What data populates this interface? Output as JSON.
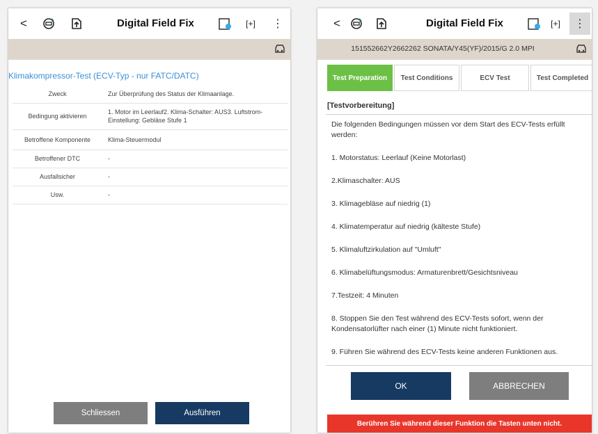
{
  "app": {
    "title": "Digital Field Fix"
  },
  "colors": {
    "accent_blue": "#3a8fd6",
    "primary_button": "#163a62",
    "secondary_button": "#7e7e7e",
    "active_tab": "#6cc045",
    "warning": "#e8362b",
    "info_bar": "#ded6cc"
  },
  "toolbar": {
    "icons": [
      "back-icon",
      "diagnostic-car-icon",
      "file-upload-icon",
      "battery-coin-icon",
      "fullscreen-icon",
      "more-vert-icon"
    ],
    "back_glyph": "<",
    "fullscreen_glyph": "[+]",
    "more_glyph": "⋮"
  },
  "left": {
    "heading": "Klimakompressor-Test (ECV-Typ - nur FATC/DATC)",
    "rows": [
      {
        "label": "Zweck",
        "value": "Zur Überprüfung des Status der Klimaanlage."
      },
      {
        "label": "Bedingung aktivieren",
        "value": "1. Motor im Leerlauf2. Klima-Schalter: AUS3. Luftstrom-Einstellung: Gebläse Stufe 1"
      },
      {
        "label": "Betroffene Komponente",
        "value": "Klima-Steuermodul"
      },
      {
        "label": "Betroffener DTC",
        "value": "-"
      },
      {
        "label": "Ausfallsicher",
        "value": "-"
      },
      {
        "label": "Usw.",
        "value": "-"
      }
    ],
    "close_label": "Schliessen",
    "run_label": "Ausführen"
  },
  "right": {
    "vehicle_info": "151552662Y2662262  SONATA/Y45(YF)/2015/G 2.0 MPI",
    "tabs": [
      {
        "label": "Test Preparation",
        "active": true
      },
      {
        "label": "Test Conditions",
        "active": false
      },
      {
        "label": "ECV Test",
        "active": false
      },
      {
        "label": "Test Completed",
        "active": false
      }
    ],
    "section_title": "[Testvorbereitung]",
    "paragraphs": [
      "Die folgenden Bedingungen müssen vor dem Start des ECV-Tests erfüllt werden:",
      "1. Motorstatus: Leerlauf (Keine Motorlast)",
      "2.Klimaschalter: AUS",
      "3. Klimagebläse auf niedrig (1)",
      "4. Klimatemperatur auf niedrig (kälteste Stufe)",
      "5. Klimaluftzirkulation auf \"Umluft\"",
      "6. Klimabelüftungsmodus: Armaturenbrett/Gesichtsniveau",
      "7.Testzeit: 4 Minuten",
      "8. Stoppen Sie den Test während des ECV-Tests sofort, wenn der Kondensatorlüfter nach einer (1) Minute nicht funktioniert.",
      "9. Führen Sie während des ECV-Tests keine anderen Funktionen aus."
    ],
    "ok_label": "OK",
    "cancel_label": "ABBRECHEN",
    "warning": "Berühren Sie während dieser Funktion die Tasten unten nicht."
  }
}
